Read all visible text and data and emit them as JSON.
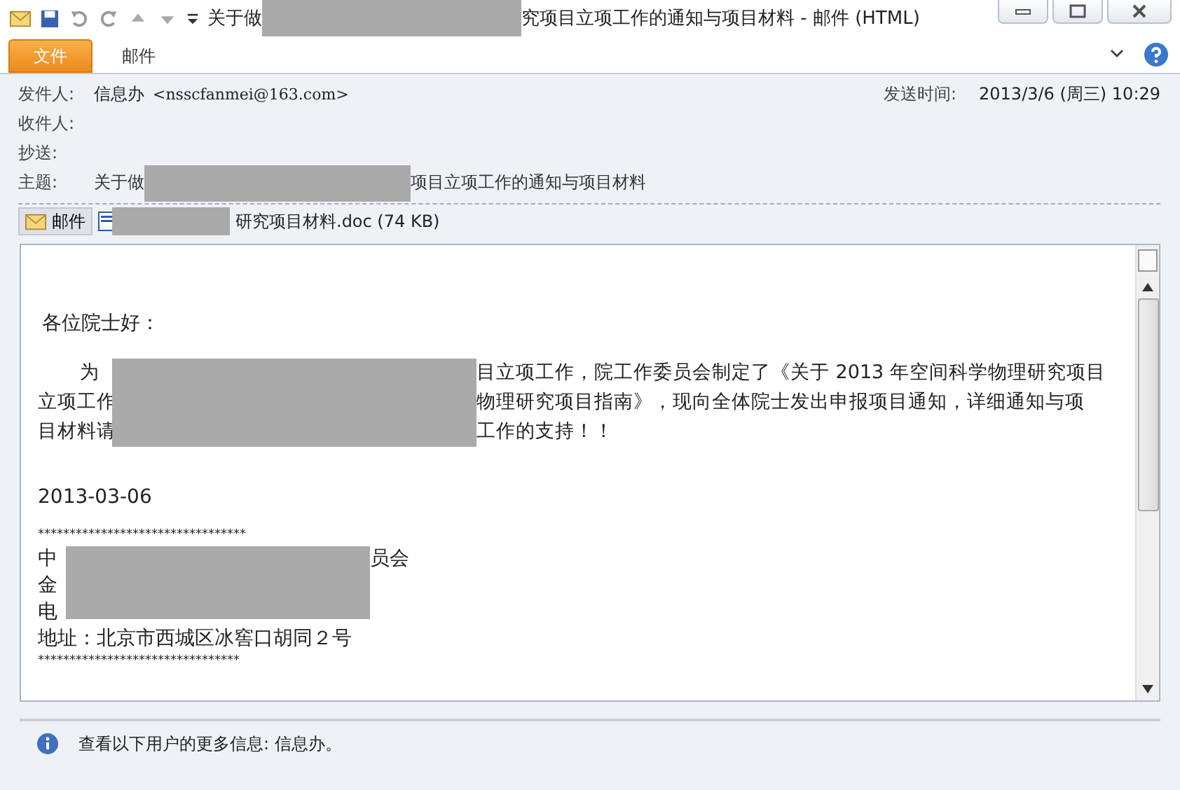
{
  "window": {
    "title_parts": [
      "关于做",
      "究项目立项工作的通知与项目材料 - 邮件 (HTML)"
    ]
  },
  "ribbon_tabs": [
    {
      "label": "文件",
      "selected": true
    },
    {
      "label": "邮件",
      "selected": false
    }
  ],
  "header": {
    "from_label": "发件人:",
    "from": "信息办",
    "from_address": "<nsscfanmei@163.com>",
    "sent_label": "发送时间:",
    "sent": "2013/3/6 (周三) 10:29",
    "to_label": "收件人:",
    "cc_label": "抄送:",
    "subject_label": "主题:",
    "subject_parts": [
      "关于做",
      "项目立项工作的通知与项目材料"
    ]
  },
  "attachments": {
    "message_tab": "邮件",
    "file": "研究项目材料.doc (74 KB)"
  },
  "body": {
    "greeting": "各位院士好：",
    "paragraph_lines": [
      {
        "left": "为",
        "right": "目立项工作，院工作委员会制定了《关于 2013 年空间科学物理研究项目"
      },
      {
        "left": "立项工作",
        "right": "物理研究项目指南》，现向全体院士发出申报项目通知，详细通知与项"
      },
      {
        "left": "目材料请",
        "right": "工作的支持！！"
      }
    ],
    "date": "2013-03-06",
    "rule_top": "*********************************",
    "signature_lines": [
      {
        "left": "中",
        "right": "员会"
      },
      {
        "left": "金"
      },
      {
        "left": "电"
      }
    ],
    "address": "地址：北京市西城区冰窖口胡同２号",
    "rule_bottom": "********************************"
  },
  "info_bar": "查看以下用户的更多信息: 信息办。"
}
